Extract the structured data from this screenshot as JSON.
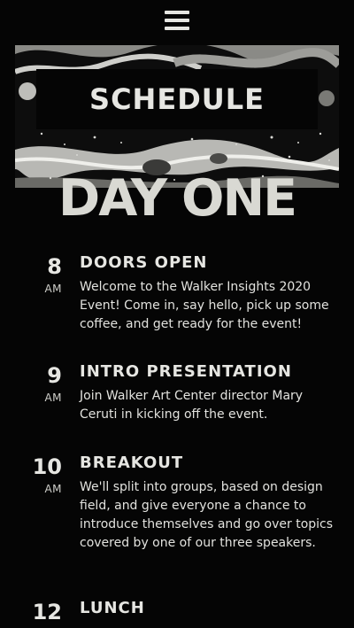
{
  "header": {
    "menu_icon": "hamburger-menu-icon"
  },
  "banner": {
    "title": "SCHEDULE"
  },
  "day": {
    "title": "DAY ONE"
  },
  "events": [
    {
      "hour": "8",
      "period": "AM",
      "title": "DOORS OPEN",
      "description": "Welcome to the Walker Insights 2020 Event! Come in, say hello, pick up some coffee, and get ready for the event!"
    },
    {
      "hour": "9",
      "period": "AM",
      "title": "INTRO PRESENTATION",
      "description": "Join Walker Art Center director Mary Ceruti in kicking off the event."
    },
    {
      "hour": "10",
      "period": "AM",
      "title": "BREAKOUT",
      "description": "We'll split into groups, based on design field, and give everyone a chance to introduce themselves and go over topics covered by one of our three speakers."
    },
    {
      "hour": "12",
      "period": "",
      "title": "LUNCH",
      "description": ""
    }
  ]
}
